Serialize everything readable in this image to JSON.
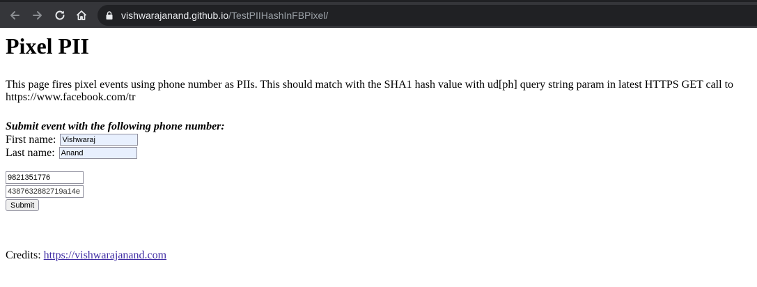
{
  "browser": {
    "url_host": "vishwarajanand.github.io",
    "url_path": "/TestPIIHashInFBPixel/"
  },
  "page": {
    "title": "Pixel PII",
    "intro": "This page fires pixel events using phone number as PIIs. This should match with the SHA1 hash value with ud[ph] query string param in latest HTTPS GET call to https://www.facebook.com/tr",
    "form_title": "Submit event with the following phone number:",
    "first_name_label": "First name:",
    "first_name_value": "Vishwaraj",
    "last_name_label": "Last name:",
    "last_name_value": "Anand",
    "phone_value": "9821351776",
    "hash_value": "4387632882719a14e",
    "submit_label": "Submit",
    "credits_label": "Credits:",
    "credits_link": "https://vishwarajanand.com"
  }
}
